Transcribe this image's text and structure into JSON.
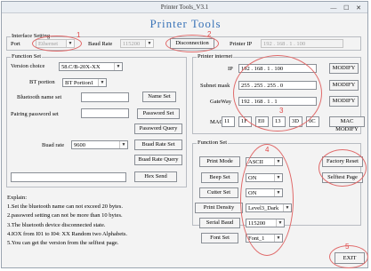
{
  "window": {
    "title": "Printer Tools_V3.1",
    "controls": "— ☐ ✕"
  },
  "app_title": "Printer Tools",
  "interface": {
    "group": "Interface Setting",
    "port_label": "Port",
    "port_value": "Ethernet",
    "baud_label": "Baud Rate",
    "baud_value": "115200",
    "disconnect_label": "Disconnection",
    "ip_label": "Printer IP",
    "ip": [
      "192",
      "168",
      "1",
      "100"
    ]
  },
  "function_set": {
    "group": "Function Set",
    "version_label": "Version choice",
    "version_value": "58.C/B-20X-XX",
    "bt_portion_label": "BT portion",
    "bt_portion_value": "BT Portion1",
    "bt_name_label": "Bluetooth name set",
    "name_set_btn": "Name Set",
    "pair_label": "Pairing password set",
    "password_set_btn": "Password Set",
    "password_query_btn": "Password Query",
    "buad_label": "Buad rate",
    "buad_value": "9600",
    "buad_set_btn": "Buad Rate Set",
    "buad_query_btn": "Buad Rate Query",
    "hex_send_btn": "Hex Send"
  },
  "printer_internet": {
    "group": "Printer internet",
    "ip_label": "IP",
    "ip": [
      "192",
      "168",
      "1",
      "100"
    ],
    "mask_label": "Subnet mask",
    "mask": [
      "255",
      "255",
      "255",
      "0"
    ],
    "gateway_label": "GateWay",
    "gateway": [
      "192",
      "168",
      "1",
      "1"
    ],
    "mac_label": "MAC",
    "mac": [
      "11",
      "1F",
      "E0",
      "13",
      "3D",
      "0C"
    ],
    "modify_btn": "MODIFY",
    "mac_modify_btn": "MAC MODIFY"
  },
  "function_set2": {
    "group": "Function Set",
    "print_mode_btn": "Print Mode",
    "print_mode_value": "ASCII",
    "beep_set_btn": "Beep Set",
    "beep_value": "ON",
    "cutter_set_btn": "Cutter Set",
    "cutter_value": "ON",
    "print_density_btn": "Print Density",
    "density_value": "Level3_Dark",
    "serial_baud_btn": "Serial Baud",
    "serial_baud_value": "115200",
    "font_set_btn": "Font Set",
    "font_value": "Font_1",
    "factory_reset_btn": "Factory Reset",
    "selftest_btn": "Selftest Page"
  },
  "explain": {
    "title": "Explain:",
    "lines": [
      "1.Set the bluetooth name can not exceed 20 bytes.",
      "2.password setting can not be more than 10 bytes.",
      "3.The bluetooth device disconnected state.",
      "4.IOX from I01 to I04: XX Random two Alphabets.",
      "5.You can get the version from the selftest page."
    ]
  },
  "exit_btn": "EXIT",
  "annotations": [
    "1",
    "2",
    "3",
    "4",
    "5"
  ],
  "annotation_color": "#e04848",
  "accent_color": "#3b74b8"
}
